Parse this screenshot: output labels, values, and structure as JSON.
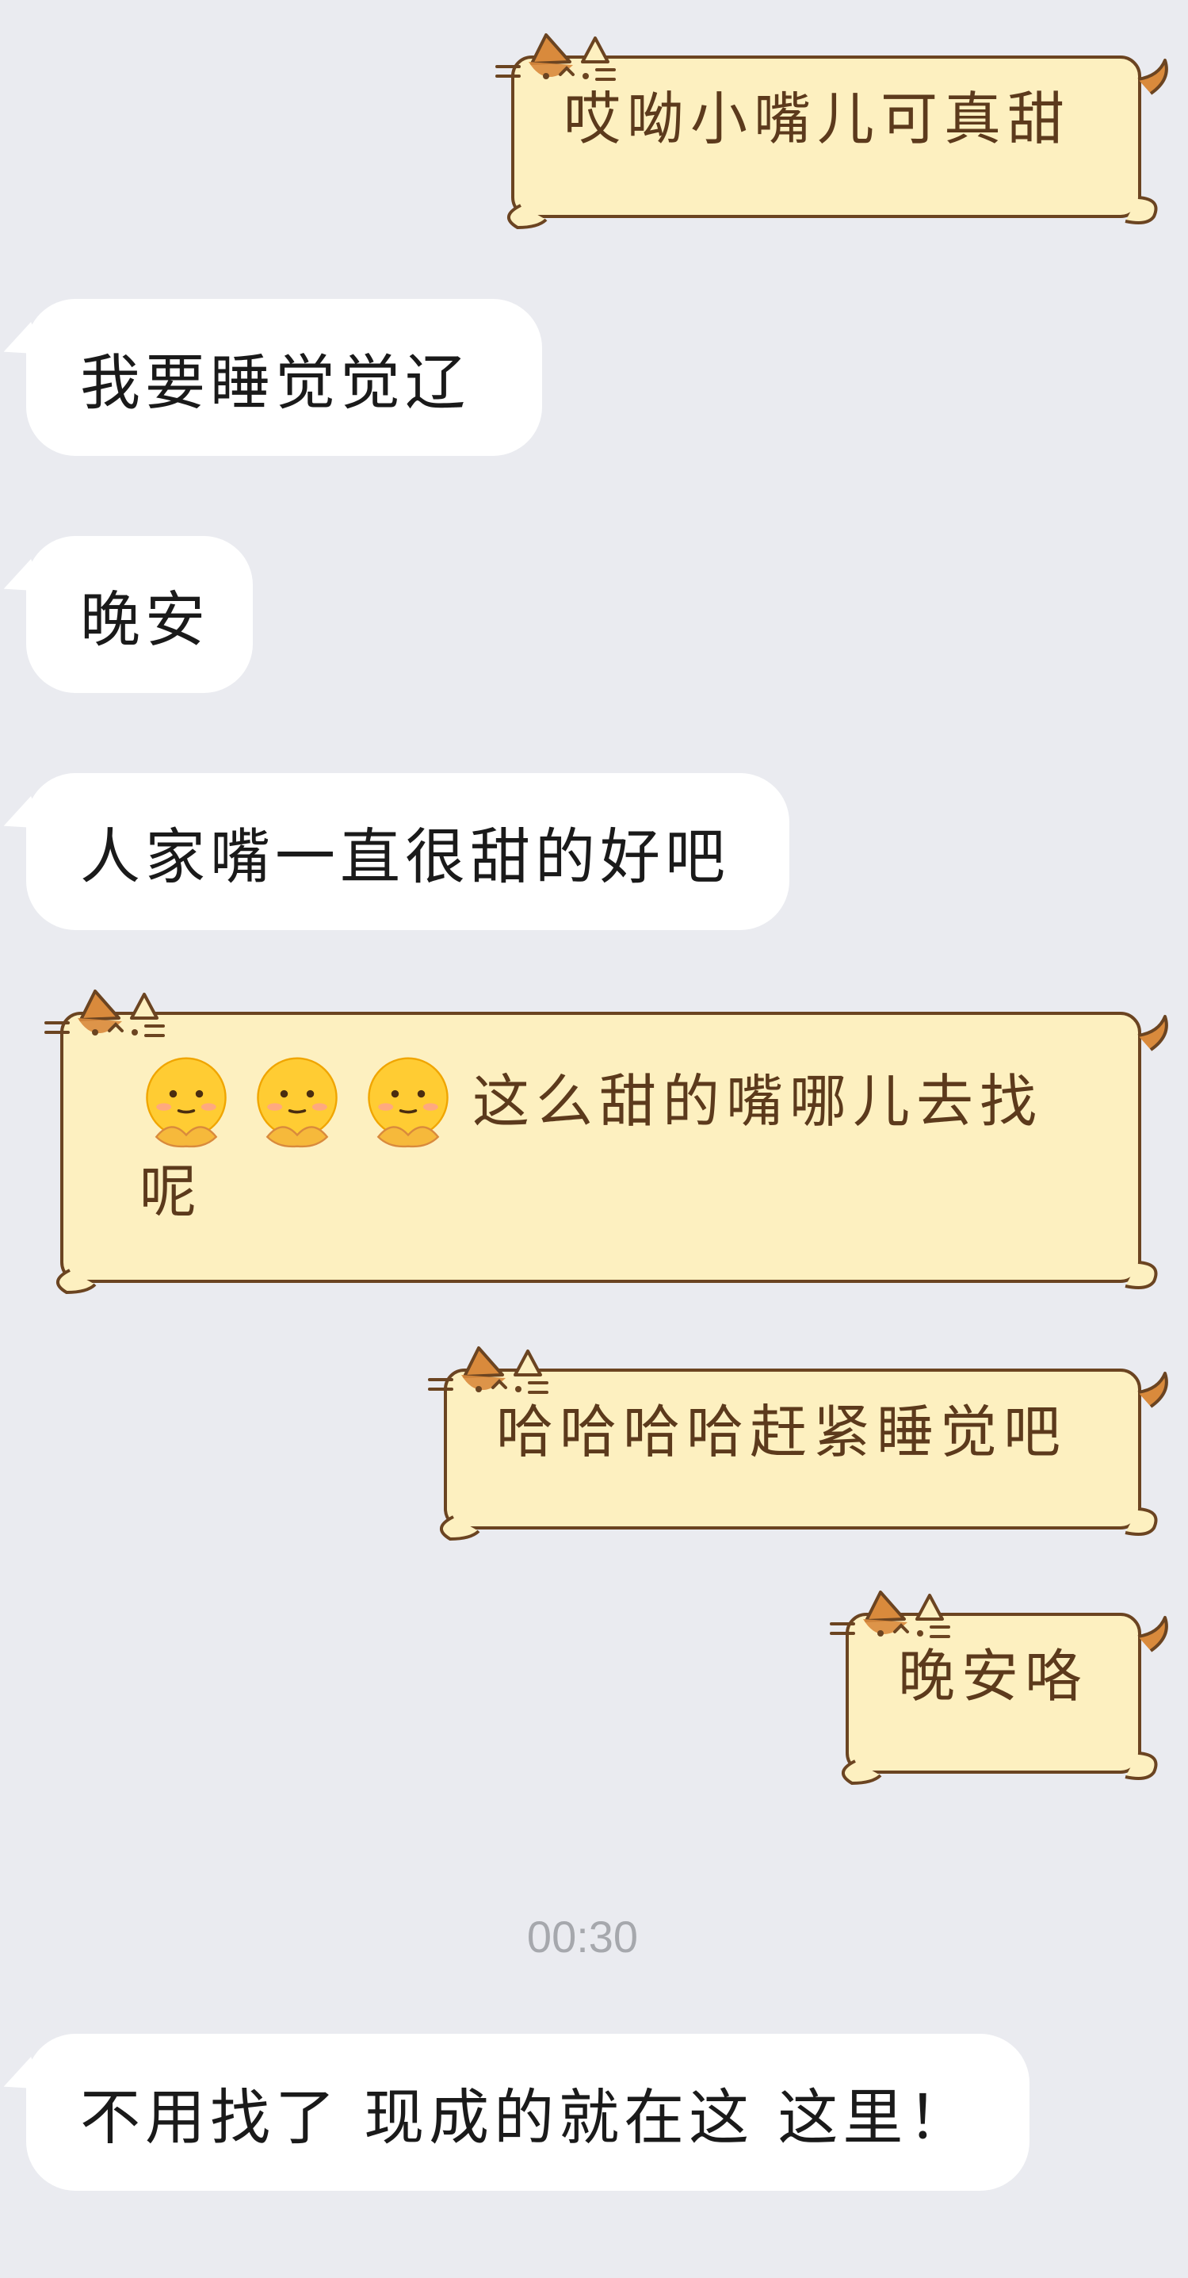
{
  "messages": [
    {
      "id": "m1",
      "side": "out",
      "text": "哎呦小嘴儿可真甜"
    },
    {
      "id": "m2",
      "side": "in",
      "text": "我要睡觉觉辽"
    },
    {
      "id": "m3",
      "side": "in",
      "text": "晚安"
    },
    {
      "id": "m4",
      "side": "in",
      "text": "人家嘴一直很甜的好吧"
    },
    {
      "id": "m5",
      "side": "out",
      "emoji": [
        "thinking-face-emoji",
        "thinking-face-emoji",
        "thinking-face-emoji"
      ],
      "text": "这么甜的嘴哪儿去找呢"
    },
    {
      "id": "m6",
      "side": "out",
      "text": "哈哈哈哈赶紧睡觉吧"
    },
    {
      "id": "m7",
      "side": "out",
      "text": "晚安咯"
    },
    {
      "id": "m8",
      "side": "in",
      "text": "不用找了 现成的就在这 这里！"
    }
  ],
  "timestamp": "00:30",
  "colors": {
    "background": "#eaebf0",
    "incoming_bubble": "#ffffff",
    "outgoing_bubble": "#fdf0c0",
    "outgoing_border": "#6b4421",
    "outgoing_text": "#5c3a1c",
    "cat_patch": "#d98a3c",
    "timestamp": "#a6a8ad"
  }
}
